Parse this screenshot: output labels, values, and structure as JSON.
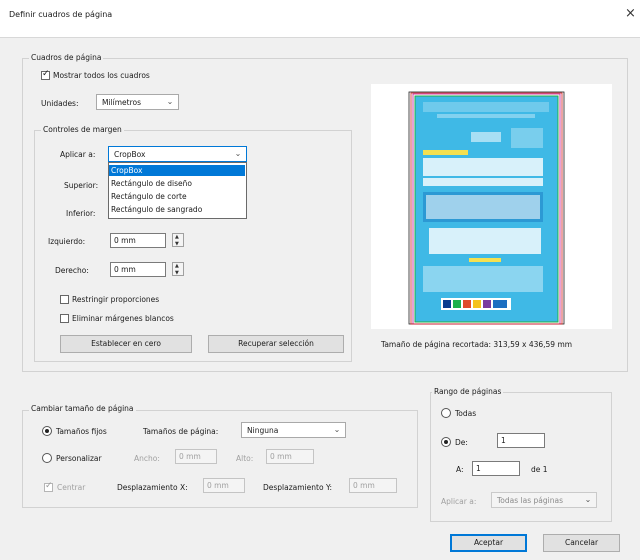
{
  "window": {
    "title": "Definir cuadros de página",
    "close_glyph": "×"
  },
  "page_boxes": {
    "legend": "Cuadros de página",
    "show_all_boxes": {
      "label": "Mostrar todos los cuadros",
      "checked": true
    },
    "units": {
      "label": "Unidades:",
      "value": "Milímetros"
    }
  },
  "margin_controls": {
    "legend": "Controles de margen",
    "apply_to": {
      "label": "Aplicar a:",
      "value": "CropBox",
      "options": [
        "CropBox",
        "Rectángulo de diseño",
        "Rectángulo de corte",
        "Rectángulo de sangrado"
      ],
      "selected_index": 0
    },
    "top": {
      "label": "Superior:"
    },
    "bottom": {
      "label": "Inferior:"
    },
    "left": {
      "label": "Izquierdo:",
      "value": "0 mm"
    },
    "right": {
      "label": "Derecho:",
      "value": "0 mm"
    },
    "constrain": {
      "label": "Restringir proporciones",
      "checked": false
    },
    "remove_white": {
      "label": "Eliminar márgenes blancos",
      "checked": false
    },
    "set_zero_button": "Establecer en cero",
    "revert_button": "Recuperar selección"
  },
  "preview": {
    "caption": "Tamaño de página recortada: 313,59 x 436,59 mm"
  },
  "change_page_size": {
    "legend": "Cambiar tamaño de página",
    "fixed_sizes": {
      "label": "Tamaños fijos",
      "selected": true
    },
    "page_sizes": {
      "label": "Tamaños de página:",
      "value": "Ninguna"
    },
    "custom": {
      "label": "Personalizar",
      "selected": false
    },
    "width": {
      "label": "Ancho:",
      "value": "0 mm"
    },
    "height": {
      "label": "Alto:",
      "value": "0 mm"
    },
    "center": {
      "label": "Centrar",
      "checked": true
    },
    "offset_x": {
      "label": "Desplazamiento X:",
      "value": "0 mm"
    },
    "offset_y": {
      "label": "Desplazamiento Y:",
      "value": "0 mm"
    }
  },
  "page_range": {
    "legend": "Rango de páginas",
    "all": {
      "label": "Todas",
      "selected": false
    },
    "from": {
      "label": "De:",
      "value": "1",
      "selected": true
    },
    "to": {
      "label": "A:",
      "value": "1",
      "suffix": "de 1"
    },
    "apply_to": {
      "label": "Aplicar a:",
      "value": "Todas las páginas"
    }
  },
  "footer": {
    "ok_button": "Aceptar",
    "cancel_button": "Cancelar"
  },
  "colors": {
    "accent": "#0078d7",
    "dialog_bg": "#f0f0f0",
    "poster_bg": "#3fb9e6"
  }
}
